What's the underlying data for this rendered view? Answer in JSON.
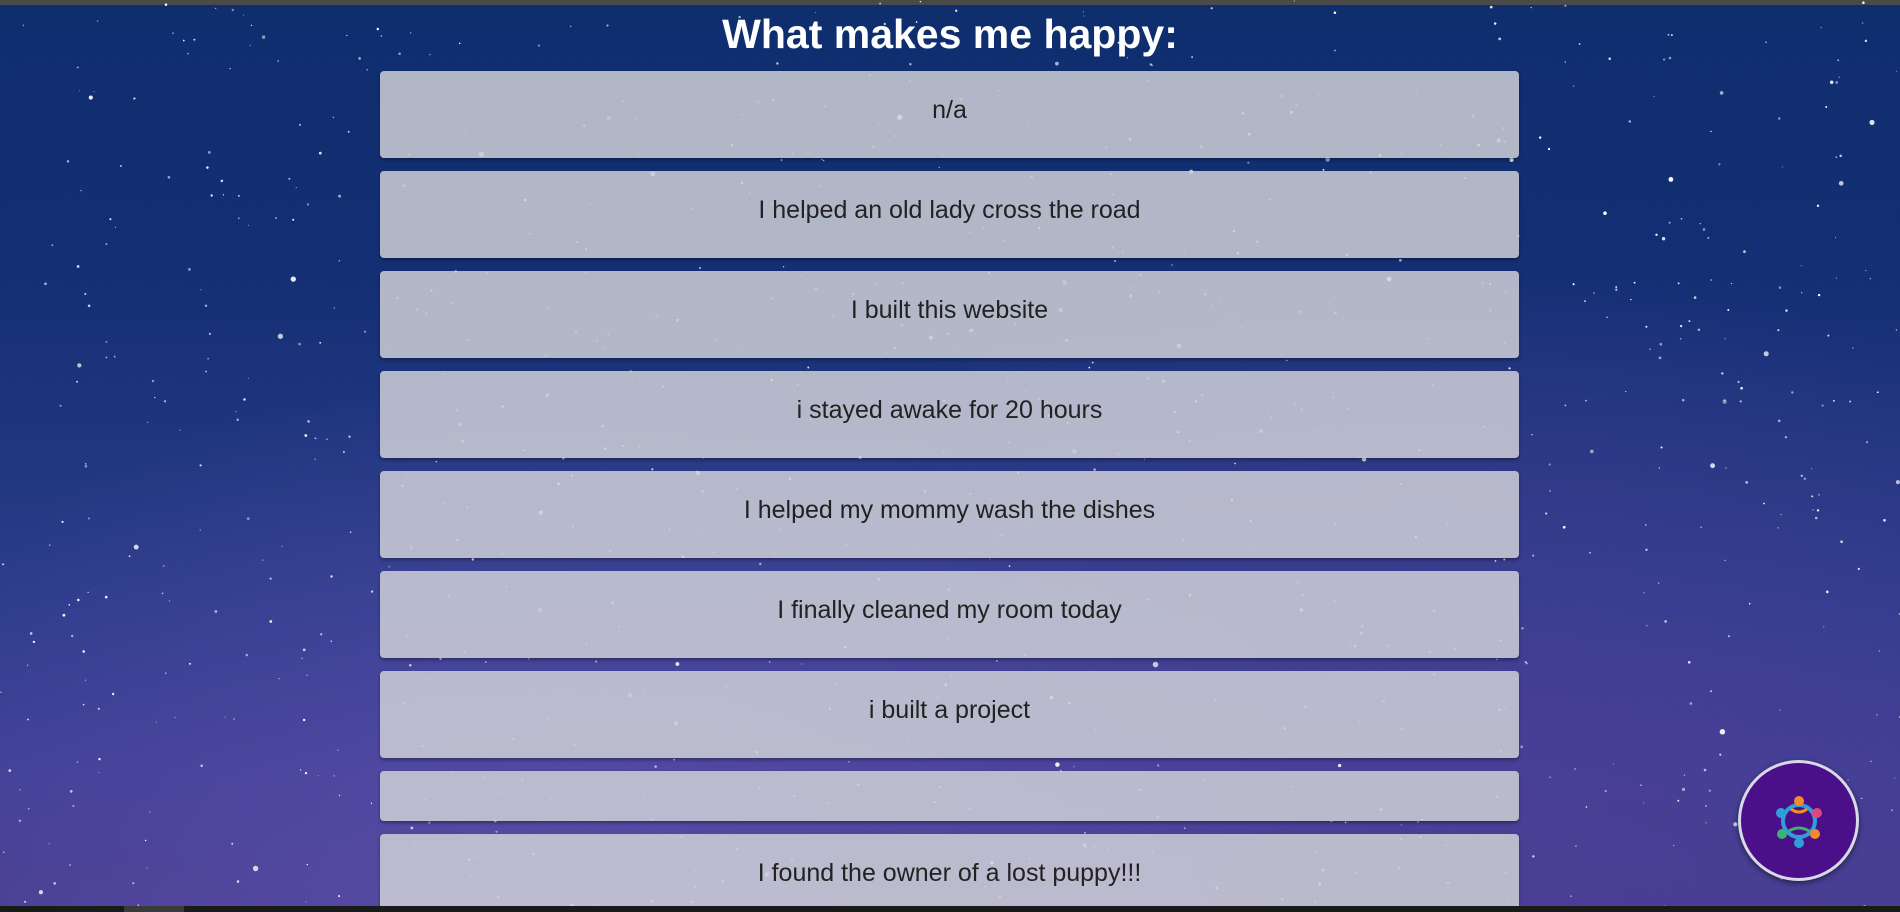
{
  "page": {
    "heading": "What makes me happy:"
  },
  "items": [
    {
      "text": "n/a"
    },
    {
      "text": "I helped an old lady cross the road"
    },
    {
      "text": "I built this website"
    },
    {
      "text": "i stayed awake for 20 hours"
    },
    {
      "text": "I helped my mommy wash the dishes"
    },
    {
      "text": "I finally cleaned my room today"
    },
    {
      "text": "i built a project"
    },
    {
      "text": ""
    },
    {
      "text": "I found the owner of a lost puppy!!!"
    }
  ],
  "fab": {
    "icon": "community-circle-icon",
    "colors": {
      "background": "#4b0f8a",
      "people": [
        "#f28c28",
        "#2f9fd8",
        "#3cb371",
        "#e0457b"
      ]
    }
  },
  "theme": {
    "card_background": "#cdced6",
    "heading_color": "#ffffff",
    "text_color": "#222222"
  }
}
